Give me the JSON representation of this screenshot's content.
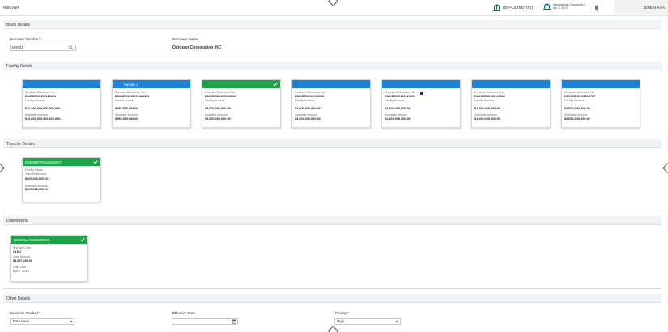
{
  "header": {
    "app_title": "RollOver",
    "branch": "DEFAULTENTITY)",
    "entity_line1": "International Operations (...",
    "entity_line2": "Apr 1, 2017",
    "user": "BINESHKAA"
  },
  "sections": {
    "basic": "Basic Details",
    "facility": "Facility Details",
    "tranche": "Tranche Details",
    "drawdowns": "Drawdowns",
    "other": "Other Details"
  },
  "basic": {
    "borrower_number_label": "Borrower Number",
    "borrower_number_value": "BR001",
    "borrower_name_label": "Borrower Name",
    "borrower_name_value": "Octosun Corporation INC"
  },
  "labels": {
    "contract_ref": "Contract Reference No",
    "facility_amount": "Facility Amount",
    "available_amount": "Available Amount",
    "facility_name": "Facility Name",
    "tranche_amount": "Tranche Amount",
    "product_code": "Product Code",
    "loan_amount": "Loan Amount",
    "start_date": "Start Date"
  },
  "facilities": [
    {
      "title": "",
      "ref": "DMOBRD0150920601",
      "facility_amount": "$10,000,000,000,000,000.-",
      "available": "$10,000,000,000,000,000.-",
      "selected": false
    },
    {
      "title": "Facility 1",
      "ref": "DMOBRD0150913A4W4",
      "facility_amount": "$550,550,000.00",
      "available": "$550,550,000.00",
      "selected": false
    },
    {
      "title": "",
      "ref": "DMOBRD0150920602",
      "facility_amount": "$5,000,000,000.00",
      "available": "$5,000,000,000.00",
      "selected": true
    },
    {
      "title": "",
      "ref": "DMOBRD0150920601",
      "facility_amount": "$3,000,000,000.00",
      "available": "$3,000,000,000.00",
      "selected": false
    },
    {
      "title": "",
      "ref": "DMOBRD0150920603",
      "facility_amount": "$2,400,000,000.00",
      "available": "$2,400,000,000.00",
      "selected": false
    },
    {
      "title": "",
      "ref": "DMOBRD0150920602",
      "facility_amount": "$1,000,000,000.00",
      "available": "$1,000,000,000.00",
      "selected": false
    },
    {
      "title": "",
      "ref": "DMOBRD0150920707",
      "facility_amount": "$2,000,000,000.00",
      "available": "$2,000,000,000.00",
      "selected": false
    }
  ],
  "tranche": {
    "title": "DMOBRTR150920007",
    "tranche_amount": "$500,000,000.00",
    "available": "$500,000,000.00"
  },
  "drawdown": {
    "title": "DMOCLA3150920003",
    "product_code": "CLKJ",
    "loan_amount": "$5,657,295.00",
    "start_date": "Apr 2, 2014"
  },
  "other": {
    "business_product_label": "Business Product",
    "business_product_value": "Term Loan",
    "effective_date_label": "Effective Date",
    "effective_date_value": "",
    "priority_label": "Priority",
    "priority_value": "High"
  },
  "colors": {
    "card_blue": "#1e83d8",
    "card_green": "#1fa34a",
    "required": "#cc0000"
  },
  "icons": [
    "bank-icon",
    "bell-icon",
    "search-icon",
    "check-icon",
    "calendar-icon",
    "chevron-down-icon"
  ]
}
